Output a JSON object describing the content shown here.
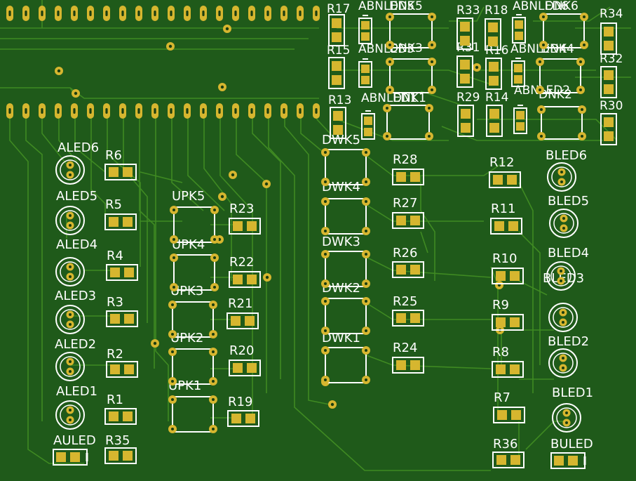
{
  "colors": {
    "board": "#1f5a1a",
    "trace": "#3f8a22",
    "pad": "#d6b62f",
    "pad_hole": "#1a3d10",
    "silk": "#ffffff"
  },
  "labels": {
    "top_left_resistors": [
      "R17",
      "R15",
      "R13"
    ],
    "top_left_leds": [
      "ABNLED5",
      "ABNLED3",
      "ABNLED1"
    ],
    "top_left_switches": [
      "DNK5",
      "DNK3",
      "DNK1"
    ],
    "top_right_resistors_a": [
      "R33",
      "R31",
      "R29"
    ],
    "top_right_resistors_b": [
      "R18",
      "R16",
      "R14"
    ],
    "top_right_leds": [
      "ABNLED6",
      "ABNLED4",
      "ABNLED2"
    ],
    "top_right_switches": [
      "DNK6",
      "DNK4",
      "DNK2"
    ],
    "far_right_resistors": [
      "R34",
      "R32",
      "R30"
    ],
    "aleds": [
      "ALED6",
      "ALED5",
      "ALED4",
      "ALED3",
      "ALED2",
      "ALED1"
    ],
    "aled_resistors": [
      "R6",
      "R5",
      "R4",
      "R3",
      "R2",
      "R1"
    ],
    "auled": "AULED",
    "auled_resistor": "R35",
    "upk_switches": [
      "UPK5",
      "UPK4",
      "UPK3",
      "UPK2",
      "UPK1"
    ],
    "upk_resistors": [
      "R23",
      "R22",
      "R21",
      "R20",
      "R19"
    ],
    "dwk_switches": [
      "DWK5",
      "DWK4",
      "DWK3",
      "DWK2",
      "DWK1"
    ],
    "dwk_resistors": [
      "R28",
      "R27",
      "R26",
      "R25",
      "R24"
    ],
    "bled_resistors": [
      "R12",
      "R11",
      "R10",
      "R9",
      "R8",
      "R7",
      "R36"
    ],
    "bleds": [
      "BLED6",
      "BLED5",
      "BLED4",
      "BLED3",
      "BLED2",
      "BLED1"
    ],
    "buled": "BULED"
  }
}
